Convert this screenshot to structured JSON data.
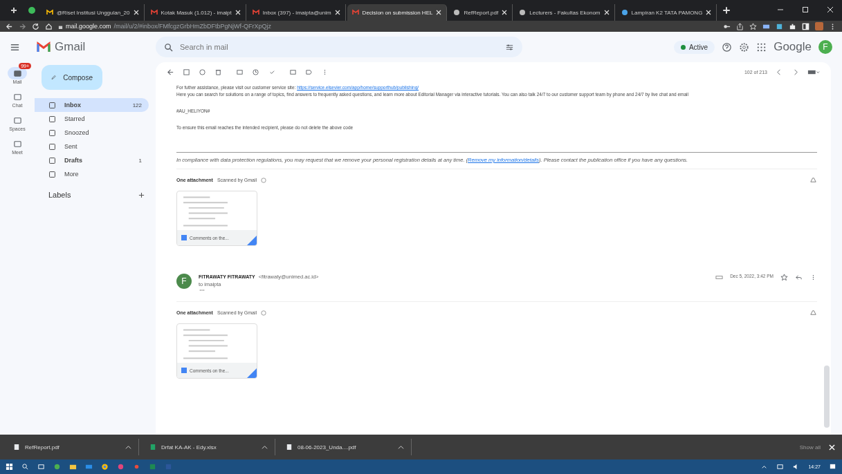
{
  "browser": {
    "tabs": [
      {
        "title": "@Riset Institusi Unggulan_20",
        "selected": false
      },
      {
        "title": "Kotak Masuk (1.012) - imaipt",
        "selected": false
      },
      {
        "title": "Inbox (397) - imaipta@unim",
        "selected": false
      },
      {
        "title": "Decision on submission HEL",
        "selected": true
      },
      {
        "title": "RefReport.pdf",
        "selected": false
      },
      {
        "title": "Lecturers - Fakultas Ekonom",
        "selected": false
      },
      {
        "title": "Lampiran K2 TATA PAMONG",
        "selected": false
      }
    ],
    "url_host": "mail.google.com",
    "url_path": "/mail/u/2/#inbox/FMfcgzGrbHmZbDFtbPgNjWf-QFrXpQjz"
  },
  "gmail": {
    "brand": "Gmail",
    "search": {
      "placeholder": "Search in mail"
    },
    "status": "Active",
    "google": "Google",
    "avatar": "F"
  },
  "rail": [
    {
      "label": "Mail",
      "badge": "99+",
      "selected": true
    },
    {
      "label": "Chat",
      "selected": false
    },
    {
      "label": "Spaces",
      "selected": false
    },
    {
      "label": "Meet",
      "selected": false
    }
  ],
  "compose": "Compose",
  "nav": [
    {
      "label": "Inbox",
      "count": "122",
      "selected": true,
      "bold": true
    },
    {
      "label": "Starred",
      "selected": false,
      "bold": false
    },
    {
      "label": "Snoozed",
      "selected": false,
      "bold": false
    },
    {
      "label": "Sent",
      "selected": false,
      "bold": false
    },
    {
      "label": "Drafts",
      "count": "1",
      "selected": false,
      "bold": true
    },
    {
      "label": "More",
      "selected": false,
      "bold": false
    }
  ],
  "labels_heading": "Labels",
  "toolbar": {
    "counter": "102 of 213"
  },
  "message1": {
    "lines": [
      {
        "text": "For futher assistance, please visit our customer service site: ",
        "link": "https://service.elsevier.com/app/home/supporthub/publishing/"
      },
      {
        "text": "Here you can search for solutions on a range of topics, find answers to frequently asked questions, and learn more about Editorial Manager via interactive tutorials. You can also talk 24/7 to our customer support team by phone and 24/7 by live chat and email"
      }
    ],
    "code": "#AU_HELIYON#",
    "notice": "To ensure this email reaches the intended recipient, please do not delete the above code",
    "footer": {
      "before": "In compliance with data protection regulations, you may request that we remove your personal registration details at any time. (",
      "link": "Remove my information/details",
      "after": "). Please contact the publication office if you have any questions."
    },
    "attachment": {
      "heading": "One attachment",
      "scanned": "Scanned by Gmail",
      "file": "Comments on the..."
    }
  },
  "message2": {
    "sender": "FITRAWATY FITRAWATY",
    "email": "<fitrawaty@unimed.ac.id>",
    "to": "to imaipta",
    "date": "Dec 5, 2022, 3:42 PM",
    "avatar": "F",
    "attachment": {
      "heading": "One attachment",
      "scanned": "Scanned by Gmail",
      "file": "Comments on the..."
    }
  },
  "downloads": [
    {
      "name": "RefReport.pdf",
      "kind": "pdf"
    },
    {
      "name": "Drfat KA-AK - Edy.xlsx",
      "kind": "xlsx"
    },
    {
      "name": "08-06-2023_Unda....pdf",
      "kind": "pdf"
    }
  ],
  "show_all": "Show all",
  "taskbar": {
    "time": "14:27"
  }
}
